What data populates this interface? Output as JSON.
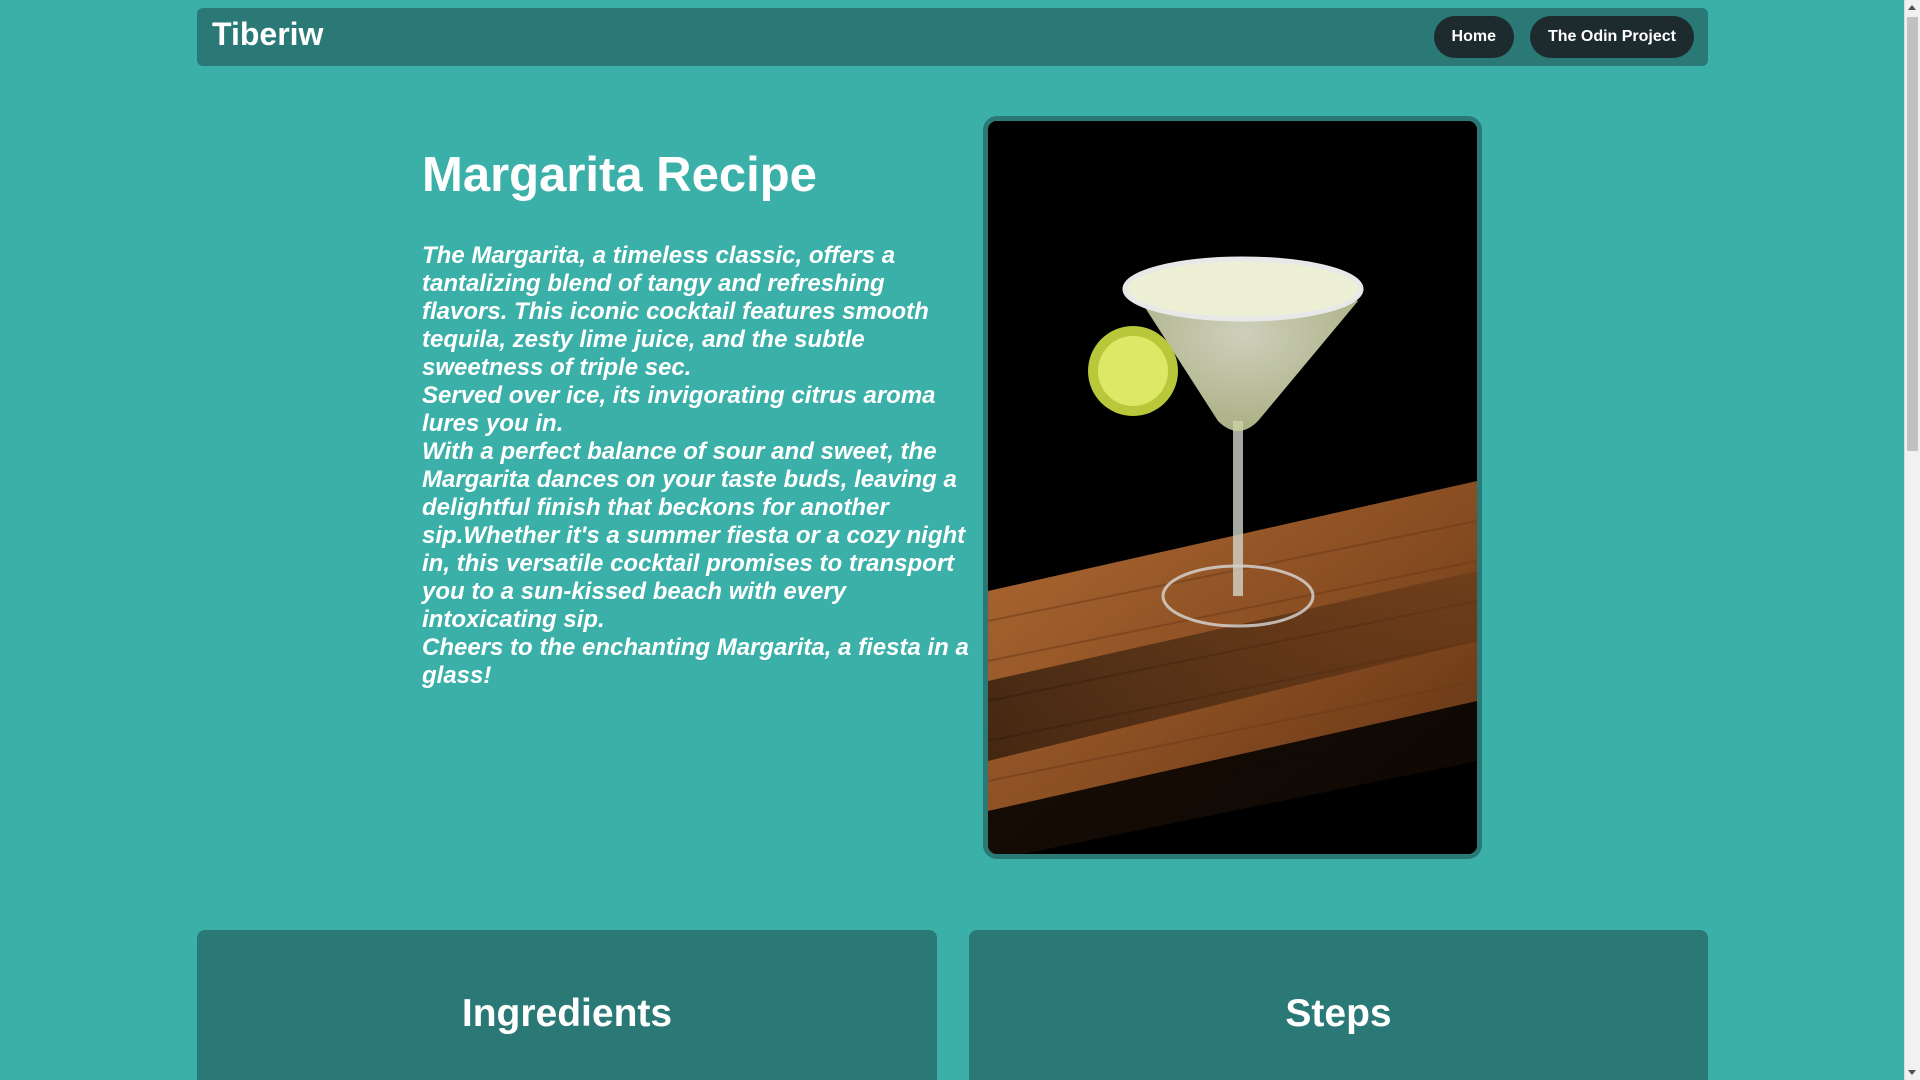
{
  "header": {
    "brand": "Tiberiw",
    "nav": {
      "home_label": "Home",
      "odin_label": "The Odin Project"
    }
  },
  "hero": {
    "title": "Margarita Recipe",
    "paragraphs": [
      "The Margarita, a timeless classic, offers a tantalizing blend of tangy and refreshing flavors. This iconic cocktail features smooth tequila, zesty lime juice, and the subtle sweetness of triple sec.",
      "Served over ice, its invigorating citrus aroma lures you in.",
      "With a perfect balance of sour and sweet, the Margarita dances on your taste buds, leaving a delightful finish that beckons for another sip.Whether it's a summer fiesta or a cozy night in, this versatile cocktail promises to transport you to a sun-kissed beach with every intoxicating sip.",
      "Cheers to the enchanting Margarita, a fiesta in a glass!"
    ]
  },
  "sections": {
    "ingredients_title": "Ingredients",
    "steps_title": "Steps"
  },
  "colors": {
    "background": "#3bb0a9",
    "panel": "#2a7976",
    "button": "#1e2b2e",
    "text": "#ffffff"
  },
  "icons": {
    "hero_image": "margarita-photo"
  }
}
